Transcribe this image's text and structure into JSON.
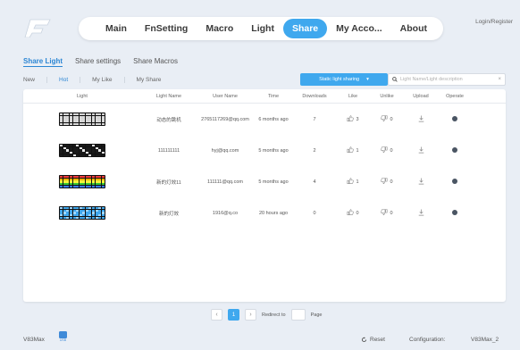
{
  "header": {
    "nav": [
      {
        "label": "Main",
        "active": false
      },
      {
        "label": "FnSetting",
        "active": false
      },
      {
        "label": "Macro",
        "active": false
      },
      {
        "label": "Light",
        "active": false
      },
      {
        "label": "Share",
        "active": true
      },
      {
        "label": "My Acco...",
        "active": false
      },
      {
        "label": "About",
        "active": false
      }
    ],
    "login": "Login/Register",
    "accent_color": "#3fa8ee"
  },
  "subtabs": [
    {
      "label": "Share Light",
      "active": true
    },
    {
      "label": "Share settings",
      "active": false
    },
    {
      "label": "Share Macros",
      "active": false
    }
  ],
  "filters": [
    {
      "label": "New",
      "active": false
    },
    {
      "label": "Hot",
      "active": true
    },
    {
      "label": "My Like",
      "active": false
    },
    {
      "label": "My Share",
      "active": false
    }
  ],
  "select": {
    "value": "Static light sharing"
  },
  "search": {
    "placeholder": "Light Name/Light description",
    "clear_icon": "close-icon"
  },
  "table": {
    "headers": [
      "Light",
      "Light Name",
      "User Name",
      "Time",
      "Downloads",
      "Like",
      "Unlike",
      "Upload",
      "Operate"
    ],
    "rows": [
      {
        "light_name": "动态的跳机",
        "user": "2765117269@qq.com",
        "time": "6 months ago",
        "downloads": "7",
        "likes": "3",
        "unlikes": "0",
        "theme": "mono"
      },
      {
        "light_name": "111111111",
        "user": "hyj@qq.com",
        "time": "5 months ago",
        "downloads": "2",
        "likes": "1",
        "unlikes": "0",
        "theme": "sparse"
      },
      {
        "light_name": "新的灯效11",
        "user": "111111@qq.com",
        "time": "5 months ago",
        "downloads": "4",
        "likes": "1",
        "unlikes": "0",
        "theme": "rainbow"
      },
      {
        "light_name": "新的灯效",
        "user": "1916@q.co",
        "time": "20 hours ago",
        "downloads": "0",
        "likes": "0",
        "unlikes": "0",
        "theme": "blue"
      }
    ]
  },
  "pagination": {
    "current": "1",
    "prev": "‹",
    "next": "›",
    "redirect_label": "Redirect to",
    "page_label": "Page"
  },
  "footer": {
    "model": "V83Max",
    "usb_label": "USB",
    "reset": "Reset",
    "config_label": "Configuration:",
    "config_value": "V83Max_2"
  }
}
